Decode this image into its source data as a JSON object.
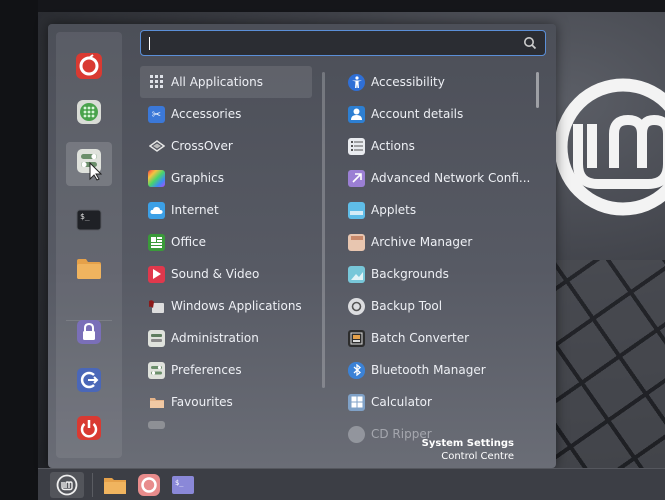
{
  "search": {
    "value": "",
    "placeholder": ""
  },
  "categories": [
    {
      "label": "All Applications",
      "icon": "grid-icon",
      "selected": true
    },
    {
      "label": "Accessories",
      "icon": "scissors-icon"
    },
    {
      "label": "CrossOver",
      "icon": "crossover-icon"
    },
    {
      "label": "Graphics",
      "icon": "graphics-icon"
    },
    {
      "label": "Internet",
      "icon": "cloud-icon"
    },
    {
      "label": "Office",
      "icon": "office-icon"
    },
    {
      "label": "Sound & Video",
      "icon": "play-icon"
    },
    {
      "label": "Windows Applications",
      "icon": "wine-icon"
    },
    {
      "label": "Administration",
      "icon": "admin-icon"
    },
    {
      "label": "Preferences",
      "icon": "preferences-icon"
    },
    {
      "label": "Favourites",
      "icon": "favourites-icon"
    }
  ],
  "apps": [
    {
      "label": "Accessibility",
      "icon": "accessibility-icon"
    },
    {
      "label": "Account details",
      "icon": "user-icon"
    },
    {
      "label": "Actions",
      "icon": "actions-icon"
    },
    {
      "label": "Advanced Network Confi...",
      "icon": "network-icon"
    },
    {
      "label": "Applets",
      "icon": "applets-icon"
    },
    {
      "label": "Archive Manager",
      "icon": "archive-icon"
    },
    {
      "label": "Backgrounds",
      "icon": "backgrounds-icon"
    },
    {
      "label": "Backup Tool",
      "icon": "backup-icon"
    },
    {
      "label": "Batch Converter",
      "icon": "batch-converter-icon"
    },
    {
      "label": "Bluetooth Manager",
      "icon": "bluetooth-icon"
    },
    {
      "label": "Calculator",
      "icon": "calculator-icon"
    },
    {
      "label": "CD Ripper",
      "icon": "cd-ripper-icon"
    }
  ],
  "system": {
    "title": "System Settings",
    "subtitle": "Control Centre"
  },
  "colors": {
    "accent": "#5b8fd8",
    "menu_bg": "#4c4f58",
    "panel_bg": "#3c3e45"
  }
}
